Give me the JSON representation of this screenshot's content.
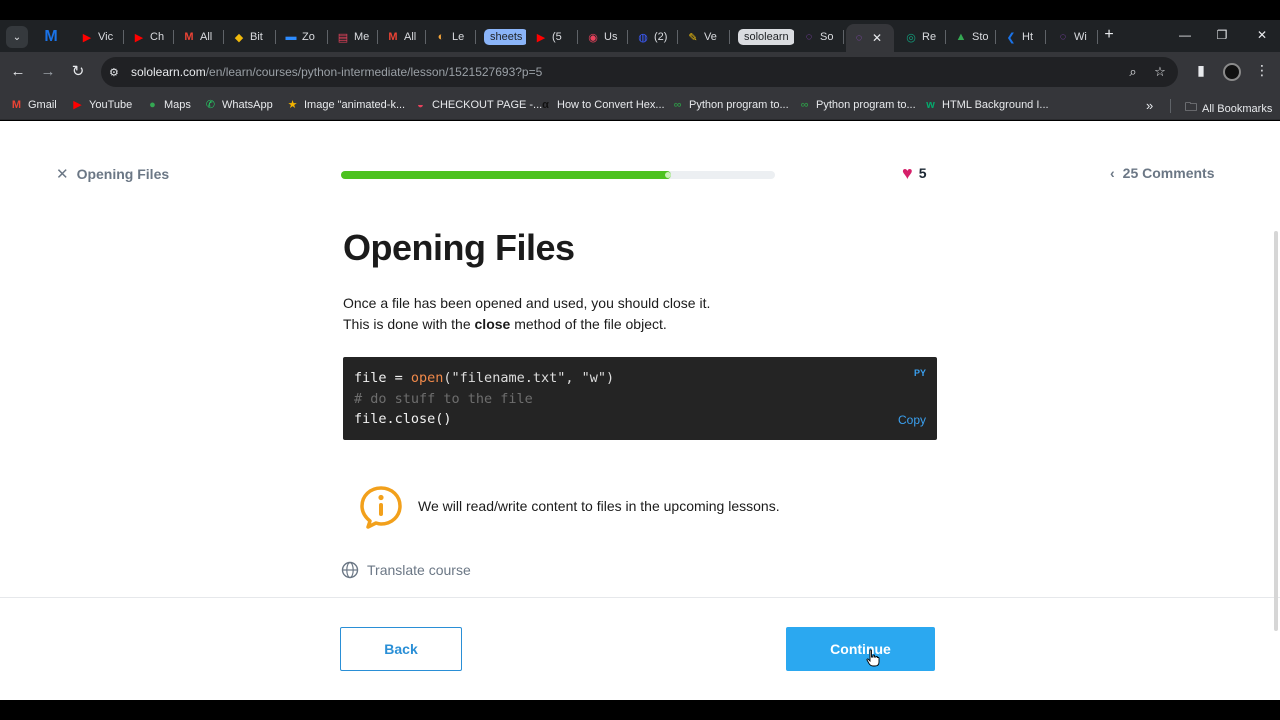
{
  "browser": {
    "tabs": [
      {
        "label": "M",
        "fav_color": "#1a73e8",
        "fav_text": "M"
      },
      {
        "label": "Vic",
        "fav_color": "#ff0000",
        "fav_text": "▶"
      },
      {
        "label": "Ch",
        "fav_color": "#ff0000",
        "fav_text": "▶"
      },
      {
        "label": "All",
        "fav_color": "#ea4335",
        "fav_text": "M"
      },
      {
        "label": "Bit",
        "fav_color": "#f0b90b",
        "fav_text": "◆"
      },
      {
        "label": "Zo",
        "fav_color": "#2d8cff",
        "fav_text": "▬"
      },
      {
        "label": "Me",
        "fav_color": "#e8425c",
        "fav_text": "▤"
      },
      {
        "label": "All",
        "fav_color": "#ea4335",
        "fav_text": "M"
      },
      {
        "label": "Le",
        "fav_color": "#f2a33a",
        "fav_text": "◐"
      },
      {
        "label": "sheets",
        "chip": true,
        "chip_color": "#8ab4f8"
      },
      {
        "label": "(5",
        "fav_color": "#ff0000",
        "fav_text": "▶"
      },
      {
        "label": "Us",
        "fav_color": "#e8425c",
        "fav_text": "◉"
      },
      {
        "label": "(2)",
        "fav_color": "#3c5cff",
        "fav_text": "◍"
      },
      {
        "label": "Ve",
        "fav_color": "#f4c20d",
        "fav_text": "✎"
      },
      {
        "label": "sololearn",
        "chip": true,
        "chip_color": "#dadce0"
      },
      {
        "label": "So",
        "fav_color": "#9c4bd6",
        "fav_text": "◌"
      },
      {
        "label": "",
        "active": true,
        "fav_color": "#9c4bd6",
        "fav_text": "◌",
        "close": "✕"
      },
      {
        "label": "Re",
        "fav_color": "#10a37f",
        "fav_text": "◎"
      },
      {
        "label": "Sto",
        "fav_color": "#34a853",
        "fav_text": "▲"
      },
      {
        "label": "Ht",
        "fav_color": "#1a73e8",
        "fav_text": "❮"
      },
      {
        "label": "Wi",
        "fav_color": "#9c4bd6",
        "fav_text": "◌"
      }
    ],
    "new_tab": "+",
    "url_host": "sololearn.com",
    "url_path": "/en/learn/courses/python-intermediate/lesson/1521527693?p=5",
    "bookmarks": [
      {
        "label": "Gmail",
        "color": "#ea4335",
        "glyph": "M"
      },
      {
        "label": "YouTube",
        "color": "#ff0000",
        "glyph": "▶"
      },
      {
        "label": "Maps",
        "color": "#34a853",
        "glyph": "●"
      },
      {
        "label": "WhatsApp",
        "color": "#25d366",
        "glyph": "✆"
      },
      {
        "label": "Image \"animated-k...",
        "color": "#f4b400",
        "glyph": "★"
      },
      {
        "label": "CHECKOUT PAGE -...",
        "color": "#e8425c",
        "glyph": "◒"
      },
      {
        "label": "How to Convert Hex...",
        "color": "#111111",
        "glyph": "α"
      },
      {
        "label": "Python program to...",
        "color": "#2f8d46",
        "glyph": "∞"
      },
      {
        "label": "Python program to...",
        "color": "#2f8d46",
        "glyph": "∞"
      },
      {
        "label": "HTML Background I...",
        "color": "#04aa6d",
        "glyph": "w"
      }
    ],
    "all_bookmarks": "All Bookmarks"
  },
  "lesson": {
    "close_label": "Opening Files",
    "progress": 0.76,
    "hearts": "5",
    "comments": "25 Comments",
    "title": "Opening Files",
    "para_line1": "Once a file has been opened and used, you should close it.",
    "para_line2_pre": "This is done with the ",
    "para_line2_bold": "close",
    "para_line2_post": " method of the file object.",
    "code": {
      "lang": "PY",
      "copy": "Copy",
      "line1_a": "file = ",
      "line1_fn": "open",
      "line1_b": "(\"filename.txt\", \"w\")",
      "line2": "# do stuff to the file",
      "line3": "file.close()"
    },
    "info_text": "We will read/write content to files in the upcoming lessons.",
    "translate": "Translate course",
    "back": "Back",
    "continue": "Continue"
  }
}
